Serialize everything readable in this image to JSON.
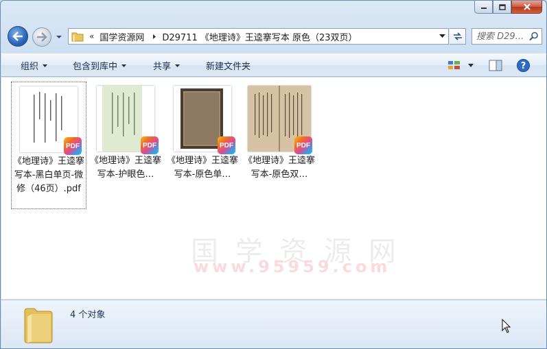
{
  "window": {
    "controls": {
      "minimize_icon": "minimize-icon",
      "maximize_icon": "maximize-icon",
      "close_icon": "close-icon"
    }
  },
  "navigation": {
    "breadcrumbs": [
      "国学资源网",
      "D29711 《地理诗》王逵搴写本 原色（23双页）"
    ],
    "overflow_glyph": "«",
    "search_placeholder": "搜索 D29..."
  },
  "toolbar": {
    "organize": "组织",
    "include_in_library": "包含到库中",
    "share": "共享",
    "new_folder": "新建文件夹"
  },
  "files": [
    {
      "name": "《地理诗》王逵搴写本-黑白单页-微修（46页）.pdf",
      "badge": "PDF",
      "style": "bw"
    },
    {
      "name": "《地理诗》王逵搴写本-护眼色…",
      "badge": "PDF",
      "style": "green"
    },
    {
      "name": "《地理诗》王逵搴写本-原色单…",
      "badge": "PDF",
      "style": "dark"
    },
    {
      "name": "《地理诗》王逵搴写本-原色双…",
      "badge": "PDF",
      "style": "tan"
    }
  ],
  "watermark": {
    "text": "国 学 资 源 网",
    "url": "www.95959.com"
  },
  "details": {
    "object_count": "4 个对象"
  },
  "colors": {
    "window_frame": "#cddff2",
    "close_button": "#c95a43",
    "accent_blue": "#2b65b8"
  }
}
